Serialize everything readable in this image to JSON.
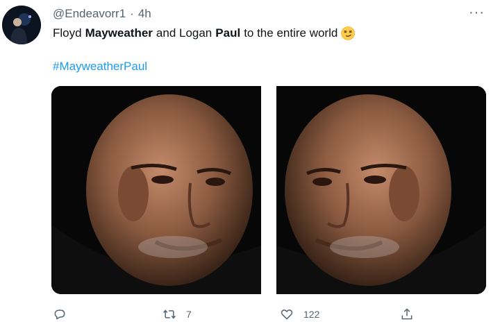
{
  "tweet": {
    "handle": "@Endeavorr1",
    "separator": "·",
    "time": "4h",
    "text_parts": {
      "p1": "Floyd",
      "p2": "Mayweather",
      "p3": "and Logan",
      "p4": "Paul",
      "p5": "to the entire world"
    },
    "emoji": "smirking-face",
    "hashtag": "#MayweatherPaul",
    "more_label": "···"
  },
  "actions": {
    "reply_icon": "reply-icon",
    "retweet_count": "7",
    "like_count": "122",
    "share_icon": "share-icon"
  },
  "colors": {
    "hashtag": "#1d9bf0",
    "secondary_text": "#536471"
  }
}
